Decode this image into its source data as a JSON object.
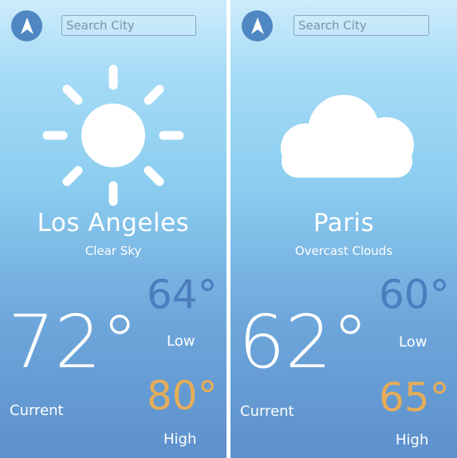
{
  "search": {
    "placeholder": "Search City"
  },
  "cities": [
    {
      "name": "Los Angeles",
      "condition": "Clear Sky",
      "icon": "sun-icon",
      "current_temp": "72°",
      "current_label": "Current",
      "low_temp": "64°",
      "low_label": "Low",
      "high_temp": "80°",
      "high_label": "High"
    },
    {
      "name": "Paris",
      "condition": "Overcast Clouds",
      "icon": "cloud-icon",
      "current_temp": "62°",
      "current_label": "Current",
      "low_temp": "60°",
      "low_label": "Low",
      "high_temp": "65°",
      "high_label": "High"
    }
  ],
  "colors": {
    "accent_blue": "#4f87c3",
    "low_temp": "#4b7dbd",
    "high_temp": "#e6ad58",
    "text": "#ffffff"
  }
}
